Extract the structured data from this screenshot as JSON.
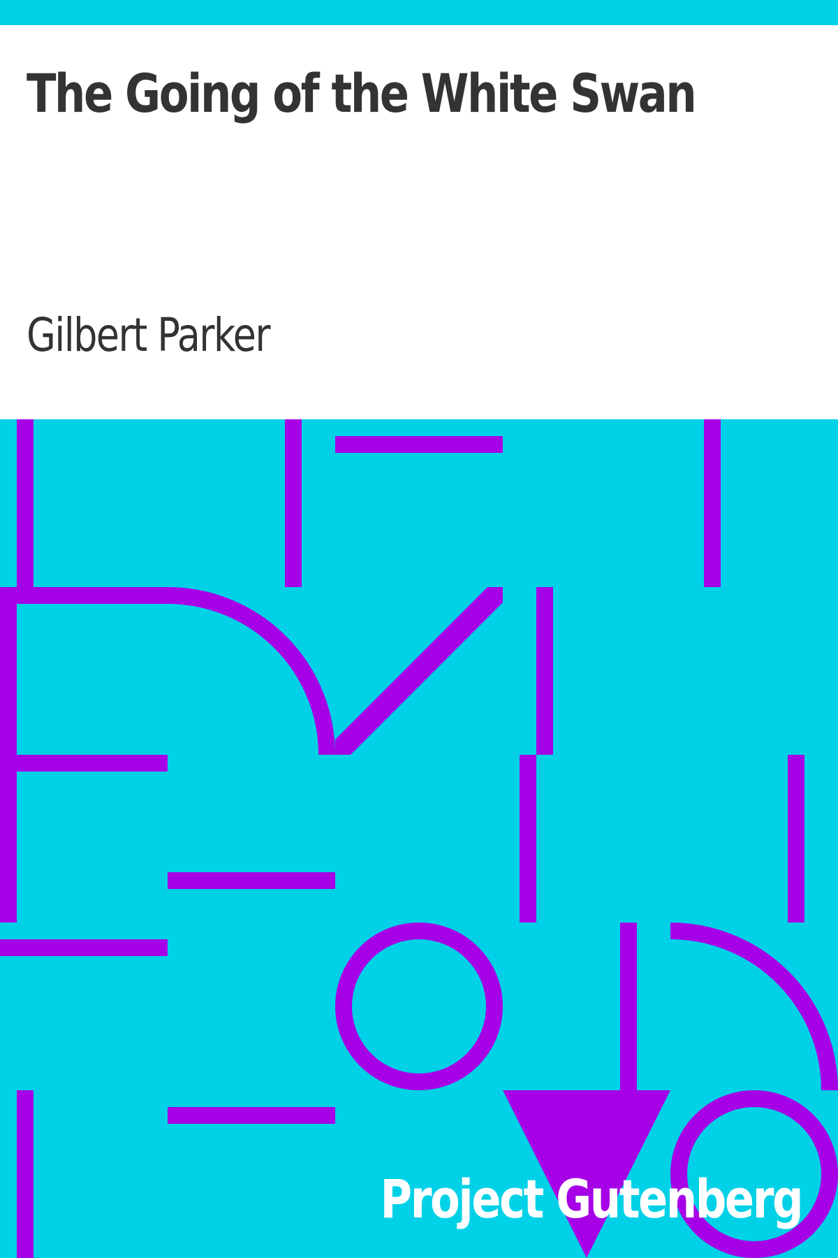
{
  "cover": {
    "title": "The Going of the White Swan",
    "author": "Gilbert Parker",
    "publisher": "Project Gutenberg"
  },
  "colors": {
    "background": "#00d1e6",
    "pattern": "#a600e6",
    "panel": "#ffffff",
    "title_text": "#333333",
    "publisher_text": "#ffffff"
  }
}
